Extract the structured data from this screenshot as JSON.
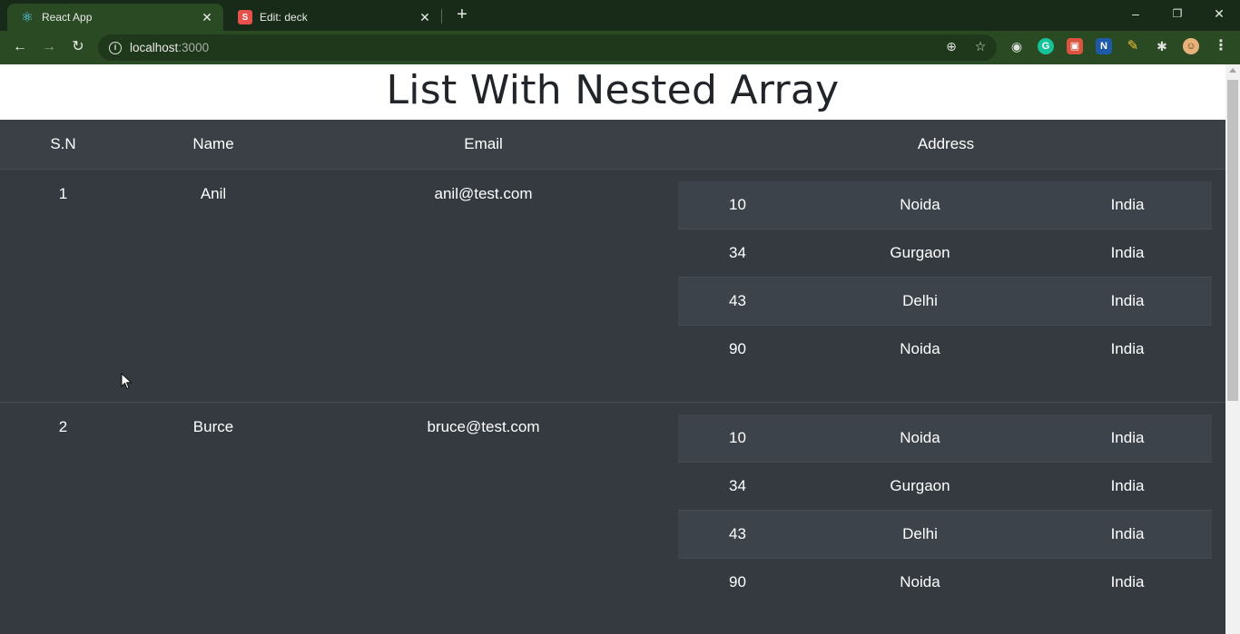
{
  "browser": {
    "tabs": [
      {
        "title": "React App",
        "favicon": "react-icon"
      },
      {
        "title": "Edit: deck",
        "favicon": "s-icon"
      }
    ],
    "new_tab": "+",
    "url_host": "localhost",
    "url_port": ":3000",
    "controls": {
      "minimize": "–",
      "restore": "❐",
      "close": "✕"
    }
  },
  "page": {
    "title": "List With Nested Array",
    "headers": {
      "sn": "S.N",
      "name": "Name",
      "email": "Email",
      "address": "Address"
    },
    "users": [
      {
        "sn": "1",
        "name": "Anil",
        "email": "anil@test.com",
        "address": [
          {
            "hn": "10",
            "city": "Noida",
            "country": "India"
          },
          {
            "hn": "34",
            "city": "Gurgaon",
            "country": "India"
          },
          {
            "hn": "43",
            "city": "Delhi",
            "country": "India"
          },
          {
            "hn": "90",
            "city": "Noida",
            "country": "India"
          }
        ]
      },
      {
        "sn": "2",
        "name": "Burce",
        "email": "bruce@test.com",
        "address": [
          {
            "hn": "10",
            "city": "Noida",
            "country": "India"
          },
          {
            "hn": "34",
            "city": "Gurgaon",
            "country": "India"
          },
          {
            "hn": "43",
            "city": "Delhi",
            "country": "India"
          },
          {
            "hn": "90",
            "city": "Noida",
            "country": "India"
          }
        ]
      }
    ]
  },
  "colors": {
    "header_bg": "#3a4046",
    "row_bg": "#343a40",
    "stripe_bg": "#3d434a",
    "chrome_bg": "#2a4a24"
  }
}
